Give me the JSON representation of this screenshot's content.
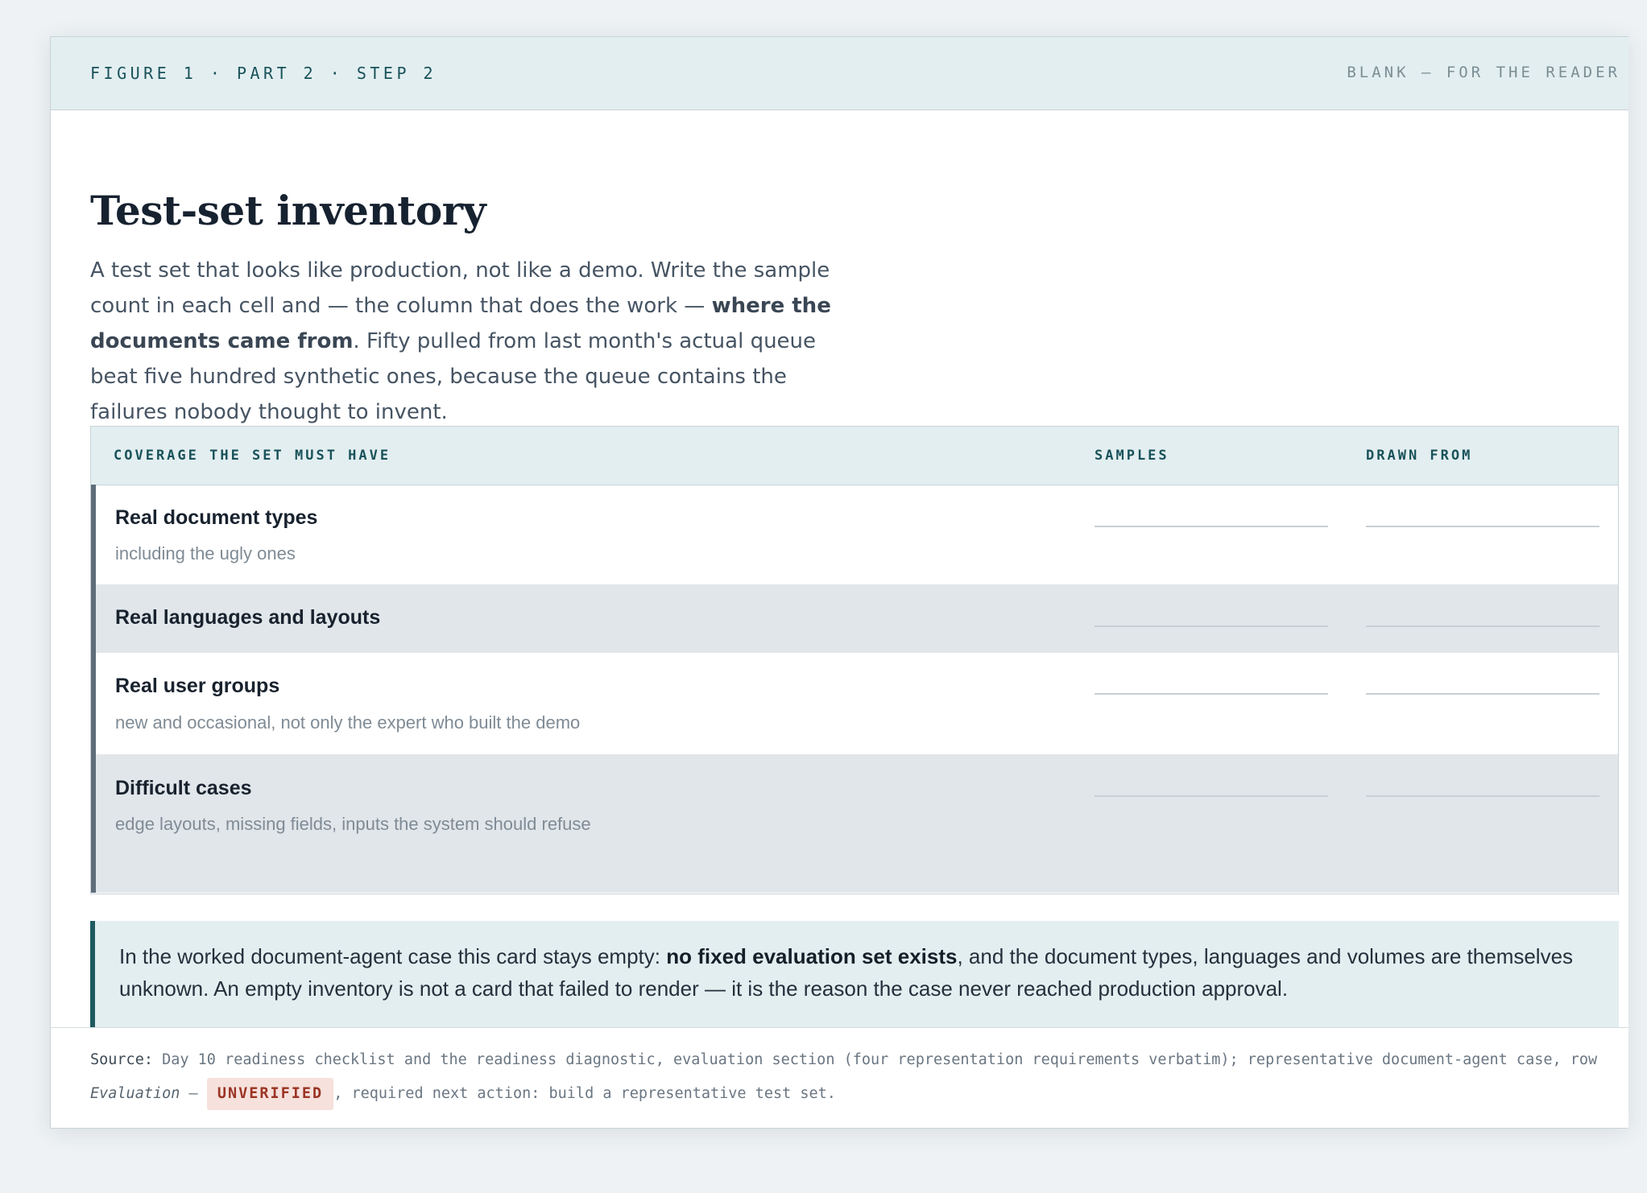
{
  "header": {
    "figure_label": "FIGURE 1 · PART 2 · STEP 2",
    "blank_label": "BLANK — FOR THE READER"
  },
  "page": {
    "title": "Test-set inventory",
    "intro_1": "A test set that looks like production, not like a demo. Write the sample count in each cell and — the column that does the work — ",
    "intro_bold": "where the documents came from",
    "intro_2": ". Fifty pulled from last month's actual queue beat five hundred synthetic ones, because the queue contains the failures nobody thought to invent."
  },
  "table": {
    "columns": [
      "COVERAGE THE SET MUST HAVE",
      "SAMPLES",
      "DRAWN FROM"
    ],
    "rows": [
      {
        "title": "Real document types",
        "subtitle": "including the ugly ones",
        "samples": "",
        "drawn_from": ""
      },
      {
        "title": "Real languages and layouts",
        "subtitle": "",
        "samples": "",
        "drawn_from": ""
      },
      {
        "title": "Real user groups",
        "subtitle": "new and occasional, not only the expert who built the demo",
        "samples": "",
        "drawn_from": ""
      },
      {
        "title": "Difficult cases",
        "subtitle": "edge layouts, missing fields, inputs the system should refuse",
        "samples": "",
        "drawn_from": ""
      }
    ]
  },
  "note": {
    "text_1": "In the worked document-agent case this card stays empty: ",
    "text_bold": "no fixed evaluation set exists",
    "text_2": ", and the document types, languages and volumes are themselves unknown. An empty inventory is not a card that failed to render — it is the reason the case never reached production approval."
  },
  "source": {
    "label": "Source:",
    "text_1": " Day 10 readiness checklist and the readiness diagnostic, evaluation section (four representation requirements verbatim); representative document-agent case, row ",
    "row_name": "Evaluation",
    "dash": " — ",
    "badge": "UNVERIFIED",
    "text_2": ", required next action: build a representative test set."
  },
  "colors": {
    "accent": "#19525a",
    "badge_bg": "#f6e1dc",
    "badge_text": "#9b3424",
    "row_alt": "#e1e6ea"
  }
}
